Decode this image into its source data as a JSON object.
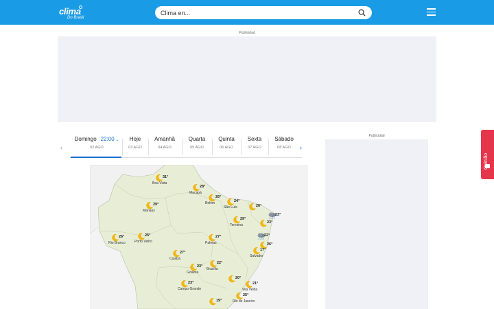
{
  "header": {
    "logo_main": "clima",
    "logo_sub": "Do Brasil",
    "search_placeholder": "Clima en..."
  },
  "ads": {
    "top_label": "Publicidad",
    "side_label": "Publicidad"
  },
  "days": [
    {
      "name": "Domingo",
      "time": "22:00",
      "date": "02 AGO",
      "active": true
    },
    {
      "name": "Hoje",
      "date": "03 AGO"
    },
    {
      "name": "Amanhã",
      "date": "04 AGO"
    },
    {
      "name": "Quarta",
      "date": "05 AGO"
    },
    {
      "name": "Quinta",
      "date": "06 AGO"
    },
    {
      "name": "Sexta",
      "date": "07 AGO"
    },
    {
      "name": "Sábado",
      "date": "08 AGO"
    }
  ],
  "cities": [
    {
      "name": "Boa Vista",
      "temp": "31°",
      "icon": "moon-icon"
    },
    {
      "name": "Macapá",
      "temp": "28°",
      "icon": "moon-icon"
    },
    {
      "name": "Belém",
      "temp": "26°",
      "icon": "moon-icon"
    },
    {
      "name": "São Luís",
      "temp": "24°",
      "icon": "moon-icon"
    },
    {
      "name": "",
      "temp": "26°",
      "icon": "moon-icon"
    },
    {
      "name": "Manaus",
      "temp": "29°",
      "icon": "moon-icon"
    },
    {
      "name": "Teresina",
      "temp": "29°",
      "icon": "moon-icon"
    },
    {
      "name": "",
      "temp": "23°",
      "icon": "cloud-rain-icon"
    },
    {
      "name": "",
      "temp": "23°",
      "icon": "moon-icon"
    },
    {
      "name": "Rio Branco",
      "temp": "26°",
      "icon": "moon-icon"
    },
    {
      "name": "Porto Velho",
      "temp": "25°",
      "icon": "moon-icon"
    },
    {
      "name": "Palmas",
      "temp": "27°",
      "icon": "moon-icon"
    },
    {
      "name": "",
      "temp": "22°",
      "icon": "cloud-rain-icon"
    },
    {
      "name": "",
      "temp": "26°",
      "icon": "moon-icon"
    },
    {
      "name": "Cuiabá",
      "temp": "27°",
      "icon": "moon-icon"
    },
    {
      "name": "Salvador",
      "temp": "17°",
      "icon": "moon-icon"
    },
    {
      "name": "Goiânia",
      "temp": "23°",
      "icon": "moon-icon"
    },
    {
      "name": "Brasília",
      "temp": "22°",
      "icon": "moon-icon"
    },
    {
      "name": "",
      "temp": "20°",
      "icon": "moon-icon"
    },
    {
      "name": "Vila Velha",
      "temp": "21°",
      "icon": "moon-icon"
    },
    {
      "name": "Campo Grande",
      "temp": "23°",
      "icon": "moon-icon"
    },
    {
      "name": "",
      "temp": "19°",
      "icon": "moon-icon"
    },
    {
      "name": "Rio de Janeiro",
      "temp": "25°",
      "icon": "moon-icon"
    }
  ],
  "feedback": {
    "label": "Opinião"
  },
  "colors": {
    "header": "#1a9be6",
    "accent": "#1a6fd0",
    "feedback": "#e5354b",
    "land_brazil": "#e8eed6",
    "land_other": "#f3f3f3"
  }
}
